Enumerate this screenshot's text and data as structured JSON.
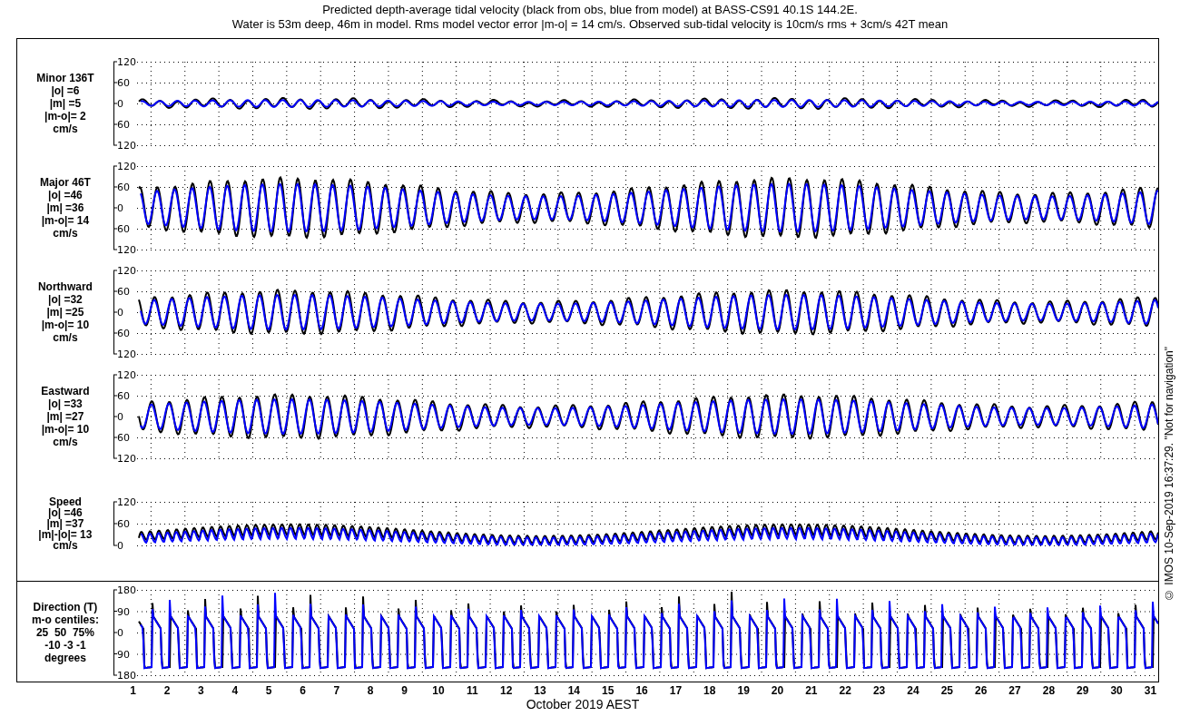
{
  "title_lines": [
    "Predicted depth-average tidal velocity (black from obs, blue from model) at BASS-CS91 40.1S 144.2E.",
    "Water is 53m deep, 46m in model. Rms model vector error |m-o| = 14 cm/s. Observed sub-tidal velocity is 10cm/s rms + 3cm/s 42T mean"
  ],
  "series": [
    {
      "color": "#000000"
    },
    {
      "color": "#0000ff"
    }
  ],
  "panels": [
    {
      "kind": "component",
      "label_lines": [
        "Minor 136T",
        "|o| =6",
        "|m| =5",
        "|m-o|= 2",
        "cm/s"
      ],
      "yticks": [
        "120",
        "60",
        "0",
        "60",
        "120"
      ]
    },
    {
      "kind": "component",
      "label_lines": [
        "Major 46T",
        "|o| =46",
        "|m| =36",
        "|m-o|= 14",
        "cm/s"
      ],
      "yticks": [
        "120",
        "60",
        "0",
        "60",
        "120"
      ]
    },
    {
      "kind": "component",
      "label_lines": [
        "Northward",
        "|o| =32",
        "|m| =25",
        "|m-o|= 10",
        "cm/s"
      ],
      "yticks": [
        "120",
        "60",
        "0",
        "60",
        "120"
      ]
    },
    {
      "kind": "component",
      "label_lines": [
        "Eastward",
        "|o| =33",
        "|m| =27",
        "|m-o|= 10",
        "cm/s"
      ],
      "yticks": [
        "120",
        "60",
        "0",
        "60",
        "120"
      ]
    },
    {
      "kind": "speed",
      "label_lines": [
        "Speed",
        "|o| =46",
        "|m| =37",
        "|m|-|o|= 13",
        "cm/s"
      ],
      "yticks": [
        "120",
        "60",
        "0"
      ]
    },
    {
      "kind": "direction",
      "label_lines": [
        "Direction (T)",
        "m-o centiles:",
        "25  50  75%",
        "-10 -3 -1",
        "degrees"
      ],
      "yticks": [
        "180",
        "90",
        "0",
        "90",
        "180"
      ]
    }
  ],
  "x_tick_labels": [
    "1",
    "2",
    "3",
    "4",
    "5",
    "6",
    "7",
    "8",
    "9",
    "10",
    "11",
    "12",
    "13",
    "14",
    "15",
    "16",
    "17",
    "18",
    "19",
    "20",
    "21",
    "22",
    "23",
    "24",
    "25",
    "26",
    "27",
    "28",
    "29",
    "30",
    "31"
  ],
  "x_label": "October 2019 AEST",
  "credit": "© IMOS 10-Sep-2019 16:37:29. \"Not for navigation\""
}
